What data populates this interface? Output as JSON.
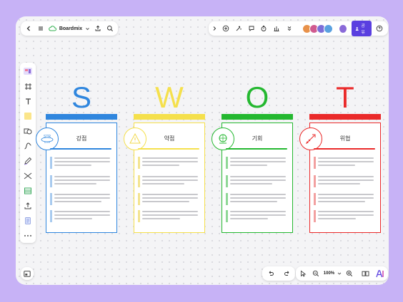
{
  "app": {
    "name": "Boardmix"
  },
  "topbar": {
    "share_label": "공유"
  },
  "zoom": {
    "level": "100%"
  },
  "swot": [
    {
      "letter": "S",
      "title": "강점",
      "color": "#2f86de",
      "accent": "#a9cbef",
      "icon": "strength-badge-icon"
    },
    {
      "letter": "W",
      "title": "약점",
      "color": "#f5e04c",
      "accent": "#f3e490",
      "icon": "weakness-warning-icon"
    },
    {
      "letter": "O",
      "title": "기회",
      "color": "#24b830",
      "accent": "#8fd896",
      "icon": "opportunity-globe-icon"
    },
    {
      "letter": "T",
      "title": "위협",
      "color": "#ea2a2a",
      "accent": "#f2a0a0",
      "icon": "threat-rocket-icon"
    }
  ]
}
